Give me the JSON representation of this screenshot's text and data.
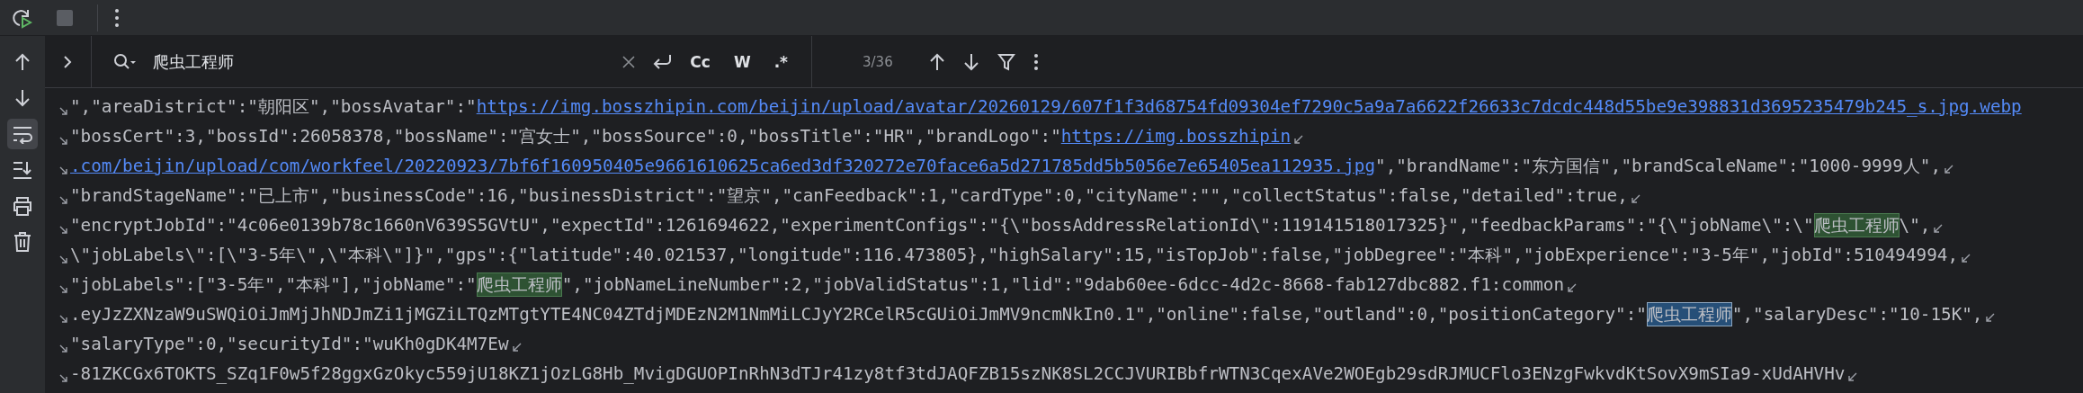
{
  "toolbar": {
    "tools": [
      {
        "kind": "rerun"
      },
      {
        "kind": "stop"
      },
      {
        "kind": "more"
      }
    ]
  },
  "sidebar": {
    "tools": [
      {
        "kind": "up",
        "selected": false
      },
      {
        "kind": "down",
        "selected": false
      },
      {
        "kind": "softwrap",
        "selected": true
      },
      {
        "kind": "scrollend",
        "selected": false
      },
      {
        "kind": "print",
        "selected": false
      },
      {
        "kind": "trash",
        "selected": false
      }
    ]
  },
  "search": {
    "value": "爬虫工程师",
    "toggles": [
      "Cc",
      "W",
      ".*"
    ],
    "count": "3/36"
  },
  "lines": [
    {
      "wrap_end": false,
      "segments": [
        {
          "kind": "text",
          "text": "\",\"areaDistrict\":\"朝阳区\",\"bossAvatar\":\""
        },
        {
          "kind": "link",
          "text": "https://img.bosszhipin.com/beijin/upload/avatar/20260129/607f1f3d68754fd09304ef7290c5a9a7a6622f26633c7dcdc448d55be9e398831d3695235479b245_s.jpg.webp"
        }
      ]
    },
    {
      "wrap_end": true,
      "segments": [
        {
          "kind": "text",
          "text": "\"bossCert\":3,\"bossId\":26058378,\"bossName\":\"宫女士\",\"bossSource\":0,\"bossTitle\":\"HR\",\"brandLogo\":\""
        },
        {
          "kind": "link",
          "text": "https://img.bosszhipin"
        }
      ]
    },
    {
      "wrap_end": true,
      "segments": [
        {
          "kind": "link",
          "text": ".com/beijin/upload/com/workfeel/20220923/7bf6f160950405e9661610625ca6ed3df320272e70face6a5d271785dd5b5056e7e65405ea112935.jpg"
        },
        {
          "kind": "text",
          "text": "\",\"brandName\":\"东方国信\",\"brandScaleName\":\"1000-9999人\","
        }
      ]
    },
    {
      "wrap_end": true,
      "segments": [
        {
          "kind": "text",
          "text": "\"brandStageName\":\"已上市\",\"businessCode\":16,\"businessDistrict\":\"望京\",\"canFeedback\":1,\"cardType\":0,\"cityName\":\"\",\"collectStatus\":false,\"detailed\":true,"
        }
      ]
    },
    {
      "wrap_end": true,
      "segments": [
        {
          "kind": "text",
          "text": "\"encryptJobId\":\"4c06e0139b78c1660nV639S5GVtU\",\"expectId\":1261694622,\"experimentConfigs\":\"{\\\"bossAddressRelationId\\\":119141518017325}\",\"feedbackParams\":\"{\\\"jobName\\\":\\\""
        },
        {
          "kind": "match",
          "text": "爬虫工程师"
        },
        {
          "kind": "text",
          "text": "\\\","
        }
      ]
    },
    {
      "wrap_end": true,
      "segments": [
        {
          "kind": "text",
          "text": "\\\"jobLabels\\\":[\\\"3-5年\\\",\\\"本科\\\"]}\",\"gps\":{\"latitude\":40.021537,\"longitude\":116.473805},\"highSalary\":15,\"isTopJob\":false,\"jobDegree\":\"本科\",\"jobExperience\":\"3-5年\",\"jobId\":510494994,"
        }
      ]
    },
    {
      "wrap_end": true,
      "segments": [
        {
          "kind": "text",
          "text": "\"jobLabels\":[\"3-5年\",\"本科\"],\"jobName\":\""
        },
        {
          "kind": "match",
          "text": "爬虫工程师"
        },
        {
          "kind": "text",
          "text": "\",\"jobNameLineNumber\":2,\"jobValidStatus\":1,\"lid\":\"9dab60ee-6dcc-4d2c-8668-fab127dbc882.f1:common"
        }
      ]
    },
    {
      "wrap_end": true,
      "segments": [
        {
          "kind": "text",
          "text": ".eyJzZXNzaW9uSWQiOiJmMjJhNDJmZi1jMGZiLTQzMTgtYTE4NC04ZTdjMDEzN2M1NmMiLCJyY2RCelR5cGUiOiJmMV9ncmNkIn0.1\",\"online\":false,\"outland\":0,\"positionCategory\":\""
        },
        {
          "kind": "current",
          "text": "爬虫工程师"
        },
        {
          "kind": "text",
          "text": "\",\"salaryDesc\":\"10-15K\","
        }
      ]
    },
    {
      "wrap_end": true,
      "segments": [
        {
          "kind": "text",
          "text": "\"salaryType\":0,\"securityId\":\"wuKh0gDK4M7Ew"
        }
      ]
    },
    {
      "wrap_end": true,
      "segments": [
        {
          "kind": "text",
          "text": "-81ZKCGx6TOKTS_SZq1F0w5f28ggxGzOkyc559jU18KZ1jOzLG8Hb_MvigDGUOPInRhN3dTJr41zy8tf3tdJAQFZB15szNK8SL2CCJVURIBbfrWTN3CqexAVe2WOEgb29sdRJMUCFlo3ENzgFwkvdKtSovX9mSIa9-xUdAHVHv"
        }
      ]
    }
  ]
}
